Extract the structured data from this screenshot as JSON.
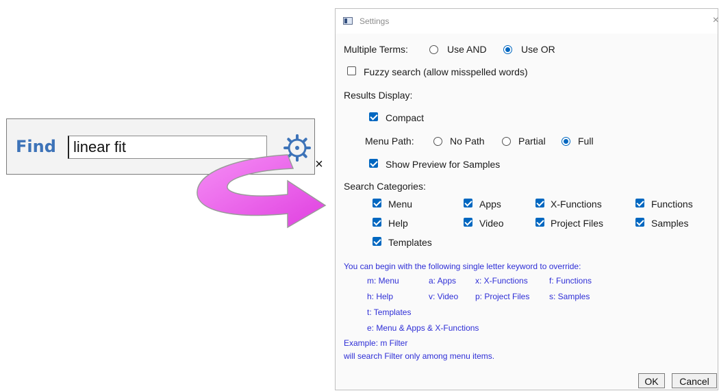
{
  "find_bar": {
    "label": "Find",
    "query": "linear fit",
    "clear_glyph": "×",
    "settings_icon": "gear-icon"
  },
  "dialog": {
    "title": "Settings",
    "close_glyph": "×",
    "multiple_terms": {
      "label": "Multiple Terms:",
      "options": [
        {
          "label": "Use AND",
          "selected": false
        },
        {
          "label": "Use OR",
          "selected": true
        }
      ]
    },
    "fuzzy": {
      "label": "Fuzzy search (allow misspelled words)",
      "checked": false
    },
    "results_display": {
      "label": "Results Display:",
      "compact": {
        "label": "Compact",
        "checked": true
      },
      "menu_path": {
        "label": "Menu Path:",
        "options": [
          {
            "label": "No Path",
            "selected": false
          },
          {
            "label": "Partial",
            "selected": false
          },
          {
            "label": "Full",
            "selected": true
          }
        ]
      },
      "show_preview": {
        "label": "Show Preview for Samples",
        "checked": true
      }
    },
    "search_categories": {
      "label": "Search Categories:",
      "items": [
        {
          "label": "Menu",
          "checked": true
        },
        {
          "label": "Apps",
          "checked": true
        },
        {
          "label": "X-Functions",
          "checked": true
        },
        {
          "label": "Functions",
          "checked": true
        },
        {
          "label": "Help",
          "checked": true
        },
        {
          "label": "Video",
          "checked": true
        },
        {
          "label": "Project Files",
          "checked": true
        },
        {
          "label": "Samples",
          "checked": true
        },
        {
          "label": "Templates",
          "checked": true
        }
      ]
    },
    "help_text": {
      "intro": "You can begin with the following single letter keyword to override:",
      "row1": [
        "m: Menu",
        "a: Apps",
        "x: X-Functions",
        "f: Functions"
      ],
      "row2": [
        "h: Help",
        "v: Video",
        "p: Project Files",
        "s: Samples"
      ],
      "row3": "t: Templates",
      "row4": "e: Menu & Apps & X-Functions",
      "example": "Example: m Filter",
      "example_desc": "will search Filter only among menu items."
    },
    "buttons": {
      "ok": "OK",
      "cancel": "Cancel"
    }
  },
  "colors": {
    "find_label": "#3d73b8",
    "accent": "#0067c0",
    "help_text": "#2e2ed6",
    "arrow_fill": "#ee55ee"
  }
}
